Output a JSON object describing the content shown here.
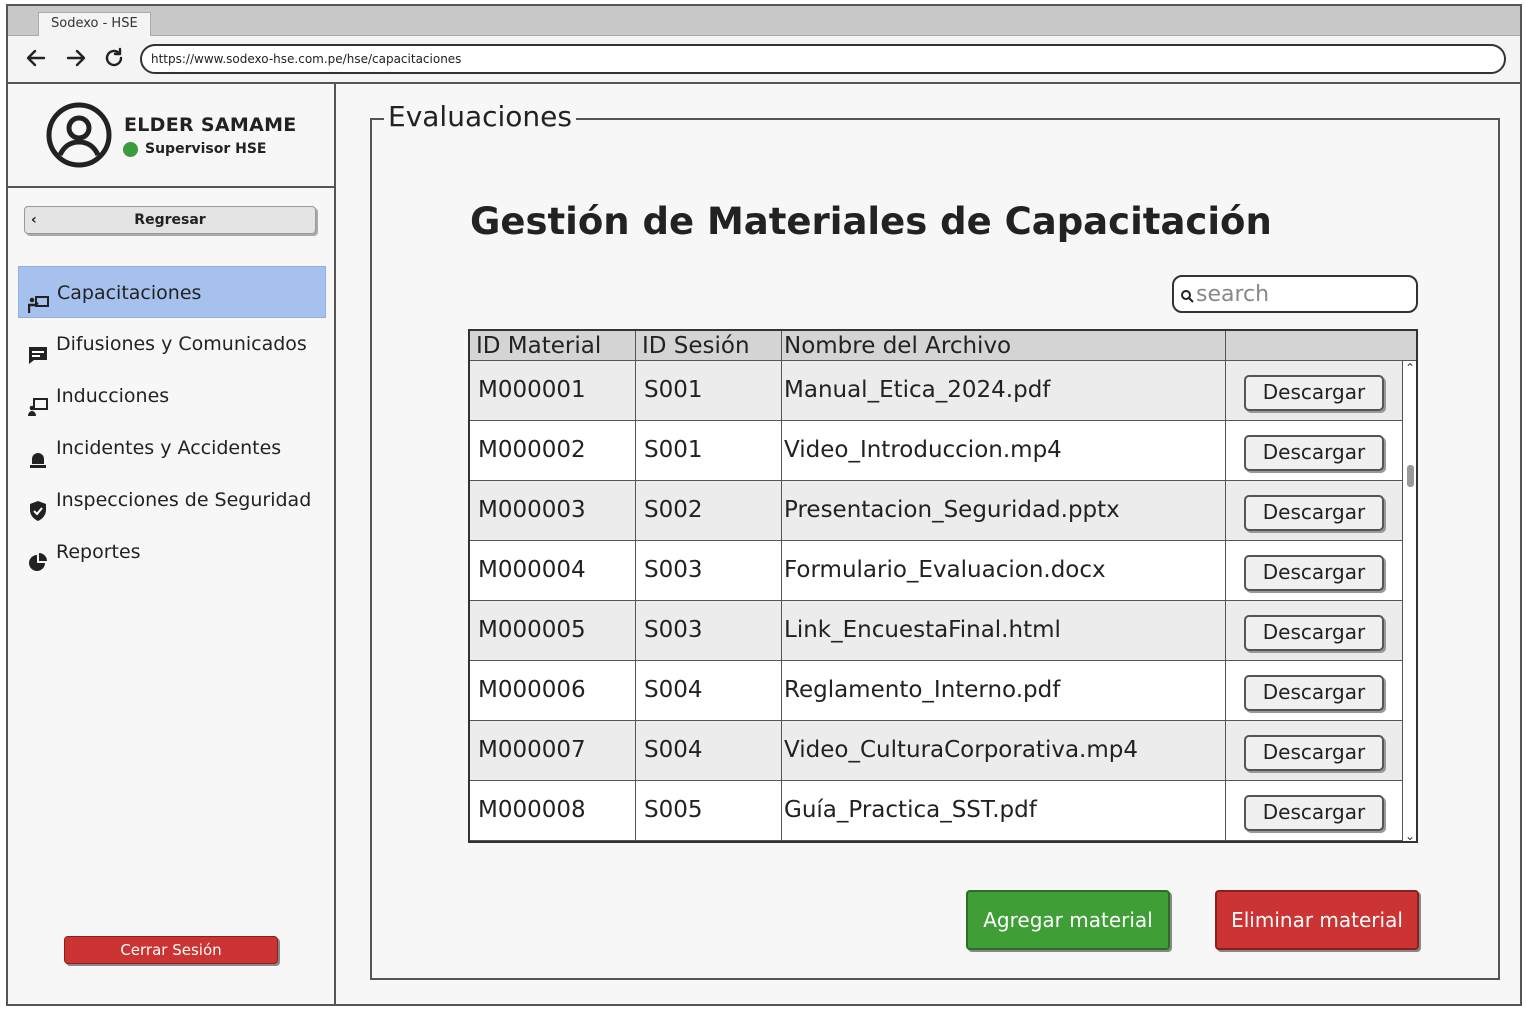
{
  "browser": {
    "tab_title": "Sodexo - HSE",
    "url": "https://www.sodexo-hse.com.pe/hse/capacitaciones"
  },
  "sidebar": {
    "user_name": "ELDER SAMAME",
    "user_role": "Supervisor HSE",
    "status_color": "#3a9c3a",
    "back_label": "Regresar",
    "items": [
      {
        "label": "Capacitaciones",
        "icon": "training-icon",
        "active": true
      },
      {
        "label": "Difusiones y Comunicados",
        "icon": "message-icon",
        "active": false
      },
      {
        "label": "Inducciones",
        "icon": "presentation-icon",
        "active": false
      },
      {
        "label": "Incidentes y Accidentes",
        "icon": "alarm-light-icon",
        "active": false
      },
      {
        "label": "Inspecciones de Seguridad",
        "icon": "shield-check-icon",
        "active": false
      },
      {
        "label": "Reportes",
        "icon": "pie-chart-icon",
        "active": false
      }
    ],
    "logout_label": "Cerrar Sesión",
    "active_color": "#a7c1ee"
  },
  "main": {
    "section_legend": "Evaluaciones",
    "title": "Gestión de Materiales de Capacitación",
    "search_placeholder": "search",
    "table": {
      "headers": [
        "ID Material",
        "ID Sesión",
        "Nombre del Archivo",
        ""
      ],
      "download_label": "Descargar",
      "rows": [
        {
          "id": "M000001",
          "session": "S001",
          "file": "Manual_Etica_2024.pdf"
        },
        {
          "id": "M000002",
          "session": "S001",
          "file": "Video_Introduccion.mp4"
        },
        {
          "id": "M000003",
          "session": "S002",
          "file": "Presentacion_Seguridad.pptx"
        },
        {
          "id": "M000004",
          "session": "S003",
          "file": "Formulario_Evaluacion.docx"
        },
        {
          "id": "M000005",
          "session": "S003",
          "file": "Link_EncuestaFinal.html"
        },
        {
          "id": "M000006",
          "session": "S004",
          "file": "Reglamento_Interno.pdf"
        },
        {
          "id": "M000007",
          "session": "S004",
          "file": "Video_CulturaCorporativa.mp4"
        },
        {
          "id": "M000008",
          "session": "S005",
          "file": "Guía_Practica_SST.pdf"
        }
      ]
    },
    "add_label": "Agregar material",
    "delete_label": "Eliminar material",
    "add_color": "#3f9e35",
    "delete_color": "#cc3333"
  }
}
